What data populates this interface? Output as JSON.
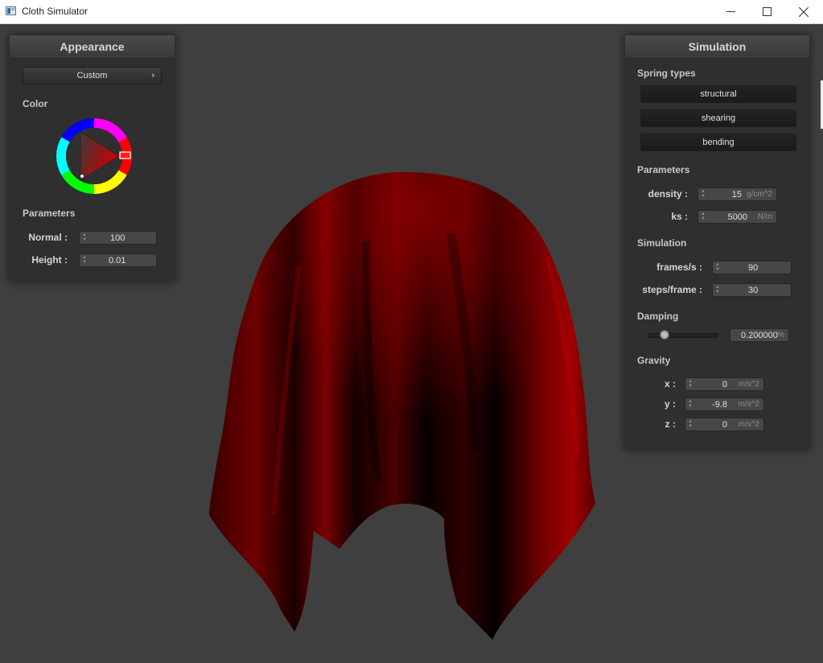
{
  "window": {
    "title": "Cloth Simulator",
    "minimize_icon": "minimize-icon",
    "maximize_icon": "maximize-icon",
    "close_icon": "close-icon"
  },
  "appearance": {
    "title": "Appearance",
    "shader_select": "Custom",
    "color_label": "Color",
    "color": "#cc0000",
    "parameters_label": "Parameters",
    "normal_label": "Normal :",
    "normal_value": "100",
    "height_label": "Height :",
    "height_value": "0.01"
  },
  "simulation": {
    "title": "Simulation",
    "spring_types_label": "Spring types",
    "spring_buttons": [
      "structural",
      "shearing",
      "bending"
    ],
    "parameters_label": "Parameters",
    "density_label": "density :",
    "density_value": "15",
    "density_unit": "g/cm^2",
    "ks_label": "ks :",
    "ks_value": "5000",
    "ks_unit": "N/m",
    "simulation_label": "Simulation",
    "fps_label": "frames/s :",
    "fps_value": "90",
    "steps_label": "steps/frame :",
    "steps_value": "30",
    "damping_label": "Damping",
    "damping_value": "0.200000",
    "damping_unit": "%",
    "damping_slider_fraction": 0.2,
    "gravity_label": "Gravity",
    "gx_label": "x :",
    "gx_value": "0",
    "gy_label": "y :",
    "gy_value": "-9.8",
    "gz_label": "z :",
    "gz_value": "0",
    "gravity_unit": "m/s^2"
  }
}
